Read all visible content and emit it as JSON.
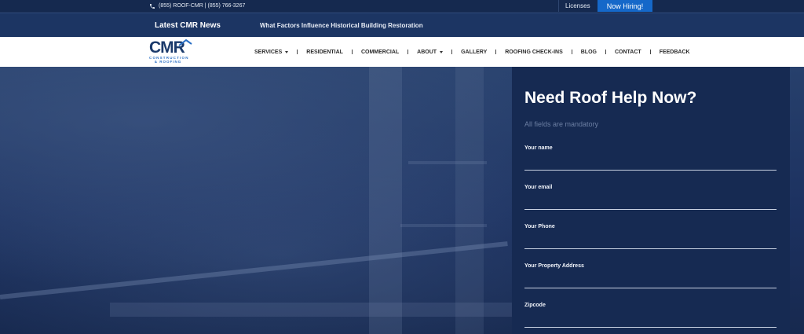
{
  "topbar": {
    "phone_text": "(855) ROOF-CMR | (855) 766-3267",
    "licenses_label": "Licenses",
    "hiring_label": "Now Hiring!"
  },
  "newsbar": {
    "label": "Latest CMR News",
    "headline": "What Factors Influence Historical Building Restoration"
  },
  "logo": {
    "mark": "CMR",
    "line1": "CONSTRUCTION",
    "line2": "& ROOFING"
  },
  "nav": {
    "items": [
      {
        "label": "SERVICES",
        "dropdown": true
      },
      {
        "label": "RESIDENTIAL"
      },
      {
        "label": "COMMERCIAL"
      },
      {
        "label": "ABOUT",
        "dropdown": true
      },
      {
        "label": "GALLERY"
      },
      {
        "label": "ROOFING CHECK-INS"
      },
      {
        "label": "BLOG"
      },
      {
        "label": "CONTACT"
      },
      {
        "label": "FEEDBACK"
      }
    ]
  },
  "form": {
    "title": "Need Roof Help Now?",
    "note": "All fields are mandatory",
    "fields": [
      {
        "label": "Your name"
      },
      {
        "label": "Your email"
      },
      {
        "label": "Your Phone"
      },
      {
        "label": "Your Property Address"
      },
      {
        "label": "Zipcode"
      }
    ]
  },
  "colors": {
    "navy": "#15294f",
    "accent_blue": "#1568c9",
    "nav_text": "#2c2c2c"
  }
}
